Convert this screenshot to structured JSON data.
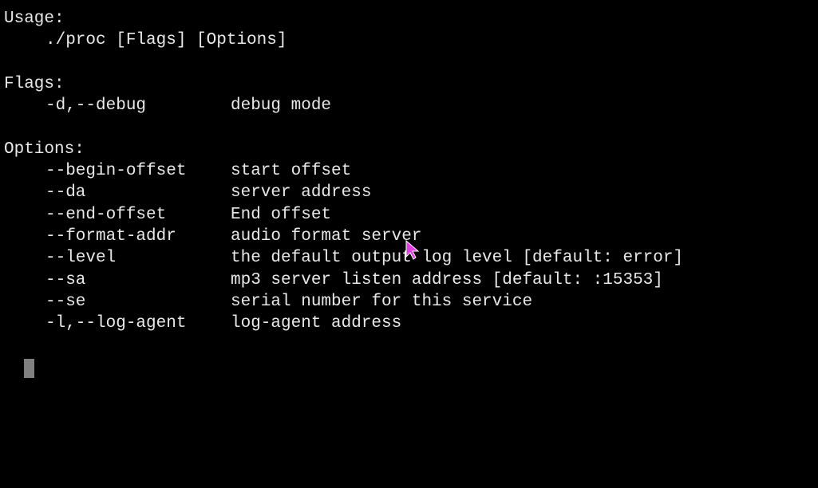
{
  "usage": {
    "header": "Usage:",
    "command": "./proc [Flags] [Options]"
  },
  "flags": {
    "header": "Flags:",
    "items": [
      {
        "flag": "-d,--debug",
        "desc": "debug mode"
      }
    ]
  },
  "options": {
    "header": "Options:",
    "items": [
      {
        "flag": "--begin-offset",
        "desc": "start offset"
      },
      {
        "flag": "--da",
        "desc": "server address"
      },
      {
        "flag": "--end-offset",
        "desc": "End offset"
      },
      {
        "flag": "--format-addr",
        "desc": "audio format server"
      },
      {
        "flag": "--level",
        "desc": "the default output log level [default: error]"
      },
      {
        "flag": "--sa",
        "desc": "mp3 server listen address [default: :15353]"
      },
      {
        "flag": "--se",
        "desc": "serial number for this service"
      },
      {
        "flag": "-l,--log-agent",
        "desc": "log-agent address"
      }
    ]
  }
}
